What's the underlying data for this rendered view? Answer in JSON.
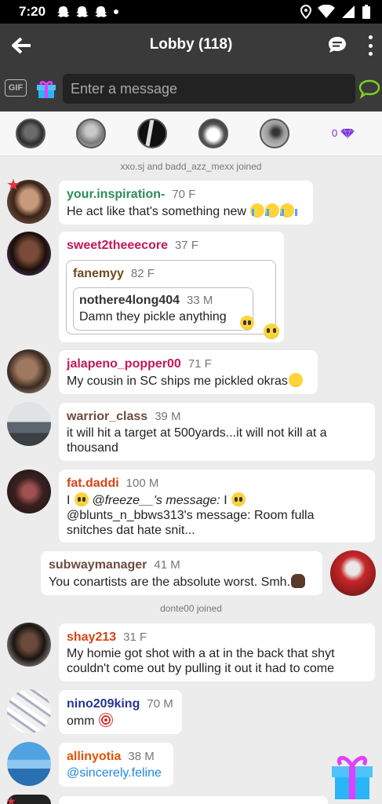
{
  "status_bar": {
    "time": "7:20"
  },
  "app_bar": {
    "title": "Lobby (118)"
  },
  "input_bar": {
    "gif_label": "GIF",
    "placeholder": "Enter a message"
  },
  "users_strip": {
    "gem_count": "0"
  },
  "system_notes": [
    "xxo.sj and badd_azz_mexx joined",
    "donte00 joined"
  ],
  "colors": {
    "header_bg": "#3a3a3a",
    "send_green": "#7ed321",
    "gem_purple": "#7b2fd0"
  },
  "messages": [
    {
      "name": "your.inspiration-",
      "age": "70 F",
      "name_color": "#2e8b57",
      "text": "He act like that's something new"
    },
    {
      "name": "sweet2theeecore",
      "age": "37 F",
      "name_color": "#c2185b",
      "quote": {
        "name": "fanemyy",
        "age": "82 F",
        "name_color": "#6d4c1f",
        "quote": {
          "name": "nothere4long404",
          "age": "33 M",
          "name_color": "#333333",
          "text": "Damn they pickle anything"
        }
      }
    },
    {
      "name": "jalapeno_popper00",
      "age": "71 F",
      "name_color": "#c2185b",
      "text": "My cousin in SC ships me pickled okras"
    },
    {
      "name": "warrior_class",
      "age": "39 M",
      "name_color": "#6d4c41",
      "text_1": "it will hit a target at 500yards...it will not kill at a",
      "text_2": "thousand"
    },
    {
      "name": "fat.daddi",
      "age": "100 M",
      "name_color": "#d84315",
      "text_i": "I",
      "text_at": "@freeze__'s message:",
      "text_i2": "I",
      "text_2": "@blunts_n_bbws313's message: Room fulla",
      "text_3": "snitches dat hate snit..."
    },
    {
      "name": "subwaymanager",
      "age": "41 M",
      "name_color": "#6d4c41",
      "text": "You conartists are the absolute worst. Smh."
    },
    {
      "name": "shay213",
      "age": "31 F",
      "name_color": "#d84315",
      "text_1": "My homie got shot with a at in the back that shyt",
      "text_2": "couldn't come out by pulling it out it had to come"
    },
    {
      "name": "nino209king",
      "age": "70 M",
      "name_color": "#283593",
      "text": "omm"
    },
    {
      "name": "allinyotia",
      "age": "38 M",
      "name_color": "#e65100",
      "text": "@sincerely.feline",
      "text_color": "#1e88e5"
    }
  ]
}
